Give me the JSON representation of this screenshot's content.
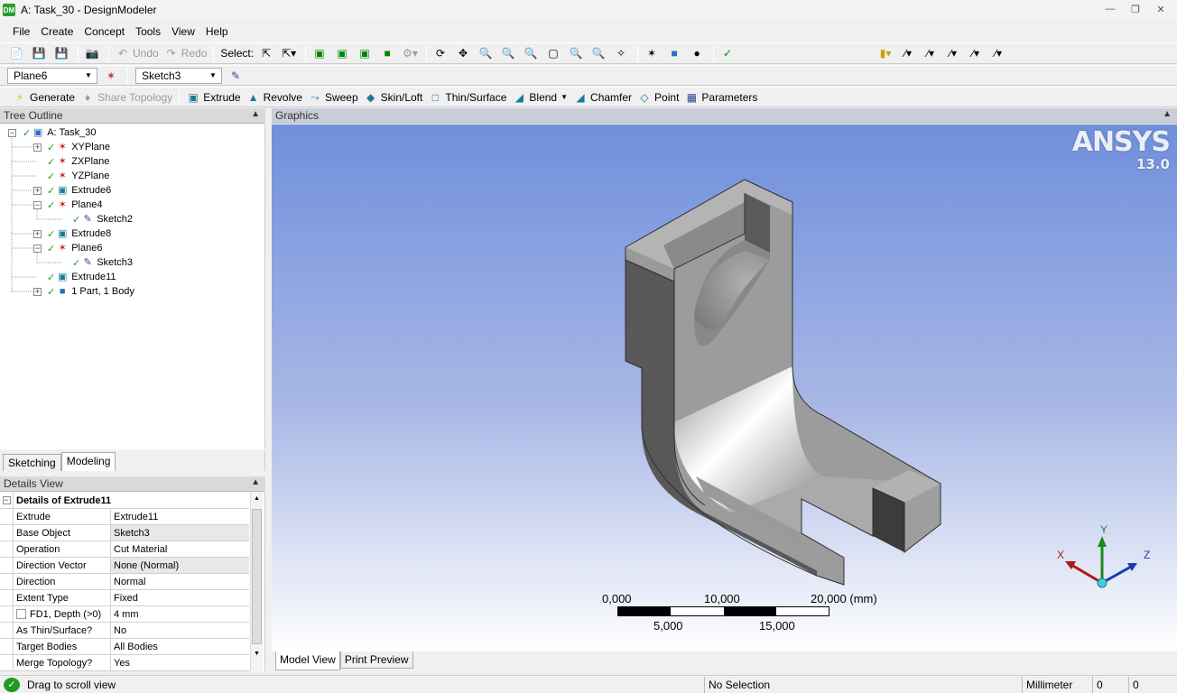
{
  "window": {
    "title": "A: Task_30 - DesignModeler",
    "app_icon": "DM"
  },
  "menu": [
    "File",
    "Create",
    "Concept",
    "Tools",
    "View",
    "Help"
  ],
  "toolbar1": {
    "undo": "Undo",
    "redo": "Redo",
    "select": "Select:"
  },
  "toolbar2": {
    "plane": "Plane6",
    "sketch": "Sketch3"
  },
  "toolbar3": {
    "generate": "Generate",
    "share_topology": "Share Topology",
    "extrude": "Extrude",
    "revolve": "Revolve",
    "sweep": "Sweep",
    "skin_loft": "Skin/Loft",
    "thin_surface": "Thin/Surface",
    "blend": "Blend",
    "chamfer": "Chamfer",
    "point": "Point",
    "parameters": "Parameters"
  },
  "tree_outline": {
    "header": "Tree Outline",
    "items": [
      {
        "label": "A: Task_30"
      },
      {
        "label": "XYPlane"
      },
      {
        "label": "ZXPlane"
      },
      {
        "label": "YZPlane"
      },
      {
        "label": "Extrude6"
      },
      {
        "label": "Plane4"
      },
      {
        "label": "Sketch2"
      },
      {
        "label": "Extrude8"
      },
      {
        "label": "Plane6"
      },
      {
        "label": "Sketch3"
      },
      {
        "label": "Extrude11"
      },
      {
        "label": "1 Part, 1 Body"
      }
    ]
  },
  "left_tabs": {
    "sketching": "Sketching",
    "modeling": "Modeling"
  },
  "details": {
    "header": "Details View",
    "title": "Details of Extrude11",
    "rows": [
      {
        "key": "Extrude",
        "value": "Extrude11"
      },
      {
        "key": "Base Object",
        "value": "Sketch3"
      },
      {
        "key": "Operation",
        "value": "Cut Material"
      },
      {
        "key": "Direction Vector",
        "value": "None (Normal)"
      },
      {
        "key": "Direction",
        "value": "Normal"
      },
      {
        "key": "Extent Type",
        "value": "Fixed"
      },
      {
        "key": "FD1,  Depth (>0)",
        "value": "4 mm"
      },
      {
        "key": "As Thin/Surface?",
        "value": "No"
      },
      {
        "key": "Target Bodies",
        "value": "All Bodies"
      },
      {
        "key": "Merge Topology?",
        "value": "Yes"
      }
    ]
  },
  "graphics": {
    "header": "Graphics",
    "brand": "ANSYS",
    "version": "13.0",
    "scale": {
      "t0": "0,000",
      "t10": "10,000",
      "t20": "20,000 (mm)",
      "t5": "5,000",
      "t15": "15,000"
    },
    "triad": {
      "x": "X",
      "y": "Y",
      "z": "Z"
    }
  },
  "view_tabs": {
    "model_view": "Model View",
    "print_preview": "Print Preview"
  },
  "status": {
    "message": "Drag to scroll view",
    "selection": "No Selection",
    "units": "Millimeter",
    "v1": "0",
    "v2": "0"
  }
}
